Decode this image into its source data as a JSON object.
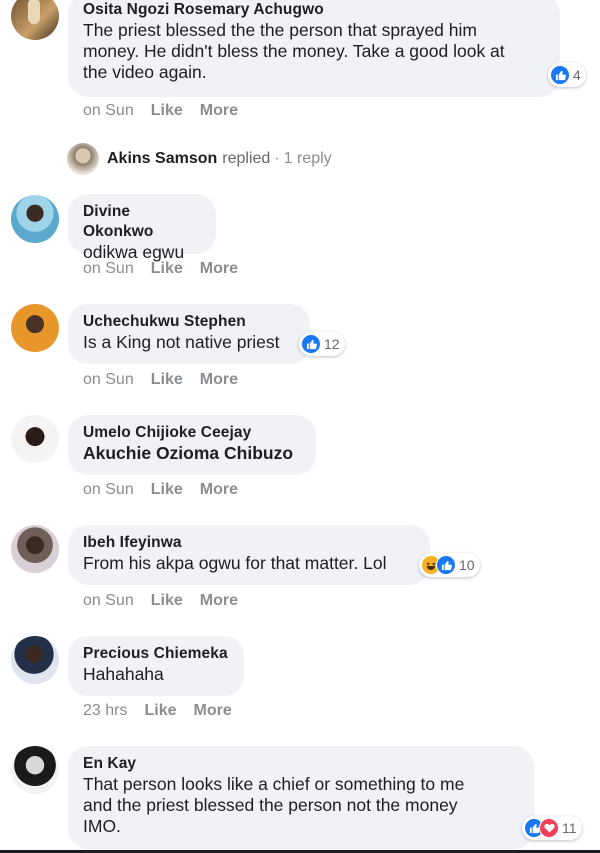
{
  "colors": {
    "like": "#1877f2",
    "love": "#f33e58",
    "haha": "#f7b125",
    "bubble": "#f0f2f5",
    "meta": "#8a8d91"
  },
  "comments": [
    {
      "name": "Osita Ngozi Rosemary Achugwo",
      "text": "The priest blessed the the person that sprayed him\nmoney. He didn't bless the money. Take a good look at\nthe video again.",
      "time": "on Sun",
      "like": "Like",
      "more": "More",
      "reactions": {
        "icons": [
          "like-icon"
        ],
        "count": "4"
      }
    },
    {
      "name": "Divine Okonkwo",
      "text": "odikwa egwu",
      "time": "on Sun",
      "like": "Like",
      "more": "More"
    },
    {
      "name": "Uchechukwu Stephen",
      "text": "Is a King not native priest",
      "time": "on Sun",
      "like": "Like",
      "more": "More",
      "reactions": {
        "icons": [
          "like-icon"
        ],
        "count": "12"
      }
    },
    {
      "name": "Umelo Chijioke Ceejay",
      "text": "Akuchie Ozioma Chibuzo",
      "time": "on Sun",
      "like": "Like",
      "more": "More"
    },
    {
      "name": "Ibeh Ifeyinwa",
      "text": "From his akpa ogwu for that matter. Lol",
      "time": "on Sun",
      "like": "Like",
      "more": "More",
      "reactions": {
        "icons": [
          "haha-icon",
          "like-icon"
        ],
        "count": "10"
      }
    },
    {
      "name": "Precious Chiemeka",
      "text": "Hahahaha",
      "time": "23 hrs",
      "like": "Like",
      "more": "More"
    },
    {
      "name": "En Kay",
      "text": "That person looks like a chief or something to me\nand the priest blessed the person not the money\nIMO.",
      "reactions": {
        "icons": [
          "like-icon",
          "love-icon"
        ],
        "count": "11"
      }
    }
  ],
  "reply_summary": {
    "name": "Akins Samson",
    "action": "replied",
    "separator": "·",
    "count": "1 reply"
  }
}
